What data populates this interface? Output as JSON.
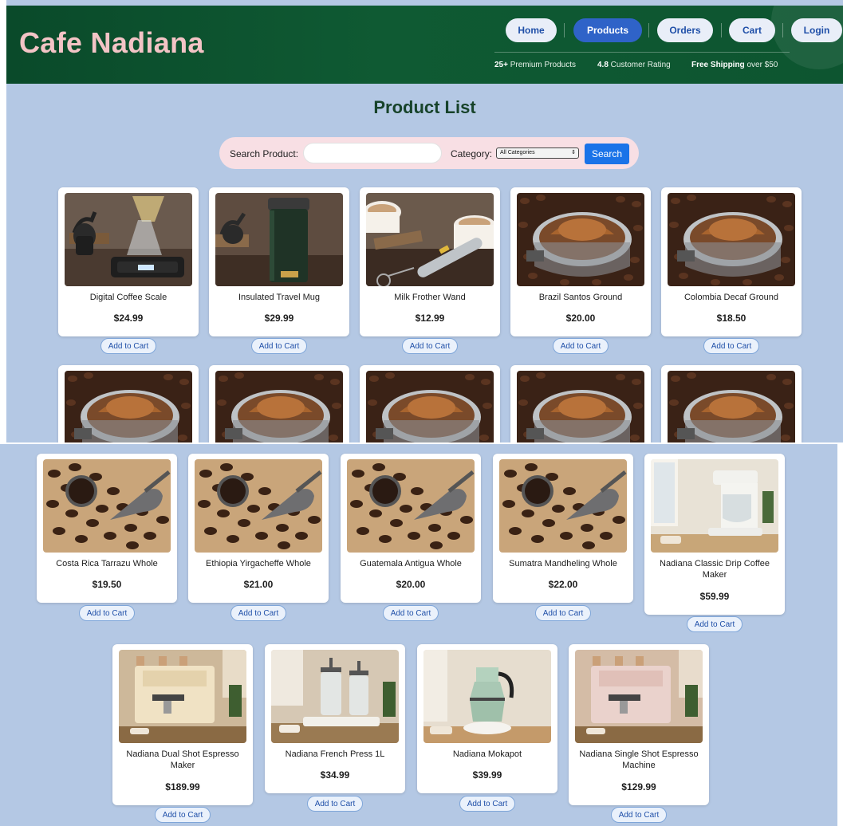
{
  "header": {
    "brand": "Cafe Nadiana",
    "nav": [
      "Home",
      "Products",
      "Orders",
      "Cart",
      "Login"
    ],
    "active_nav": "Products",
    "stats": [
      {
        "strong": "25+",
        "text": " Premium Products"
      },
      {
        "strong": "4.8",
        "text": " Customer Rating"
      },
      {
        "strong": "Free Shipping",
        "text": " over $50"
      }
    ]
  },
  "main": {
    "title": "Product List",
    "search": {
      "label": "Search Product:",
      "value": "",
      "category_label": "Category:",
      "category_value": "All Categories",
      "button": "Search"
    }
  },
  "add_to_cart_label": "Add to Cart",
  "products_row1": [
    {
      "name": "Digital Coffee Scale",
      "price": "$24.99",
      "image": "coffee-scale"
    },
    {
      "name": "Insulated Travel Mug",
      "price": "$29.99",
      "image": "travel-mug"
    },
    {
      "name": "Milk Frother Wand",
      "price": "$12.99",
      "image": "milk-frother"
    },
    {
      "name": "Brazil Santos Ground",
      "price": "$20.00",
      "image": "ground-coffee"
    },
    {
      "name": "Colombia Decaf Ground",
      "price": "$18.50",
      "image": "ground-coffee"
    }
  ],
  "products_row2_images": [
    "ground-coffee",
    "ground-coffee",
    "ground-coffee",
    "ground-coffee",
    "ground-coffee"
  ],
  "products_row3": [
    {
      "name": "Costa Rica Tarrazu Whole",
      "price": "$19.50",
      "image": "whole-beans"
    },
    {
      "name": "Ethiopia Yirgacheffe Whole",
      "price": "$21.00",
      "image": "whole-beans"
    },
    {
      "name": "Guatemala Antigua Whole",
      "price": "$20.00",
      "image": "whole-beans"
    },
    {
      "name": "Sumatra Mandheling Whole",
      "price": "$22.00",
      "image": "whole-beans"
    },
    {
      "name": "Nadiana Classic Drip Coffee Maker",
      "price": "$59.99",
      "image": "drip-maker"
    }
  ],
  "products_row4": [
    {
      "name": "Nadiana Dual Shot Espresso Maker",
      "price": "$189.99",
      "image": "espresso-machine"
    },
    {
      "name": "Nadiana French Press 1L",
      "price": "$34.99",
      "image": "french-press"
    },
    {
      "name": "Nadiana Mokapot",
      "price": "$39.99",
      "image": "mokapot"
    },
    {
      "name": "Nadiana Single Shot Espresso Machine",
      "price": "$129.99",
      "image": "espresso-machine-pink"
    }
  ],
  "colors": {
    "header_green": "#0f5a33",
    "brand_pink": "#f3c4c6",
    "page_bg": "#b4c8e4",
    "nav_active": "#2f63c8",
    "search_bg": "#f8dfe4",
    "search_button": "#1a73e8"
  }
}
